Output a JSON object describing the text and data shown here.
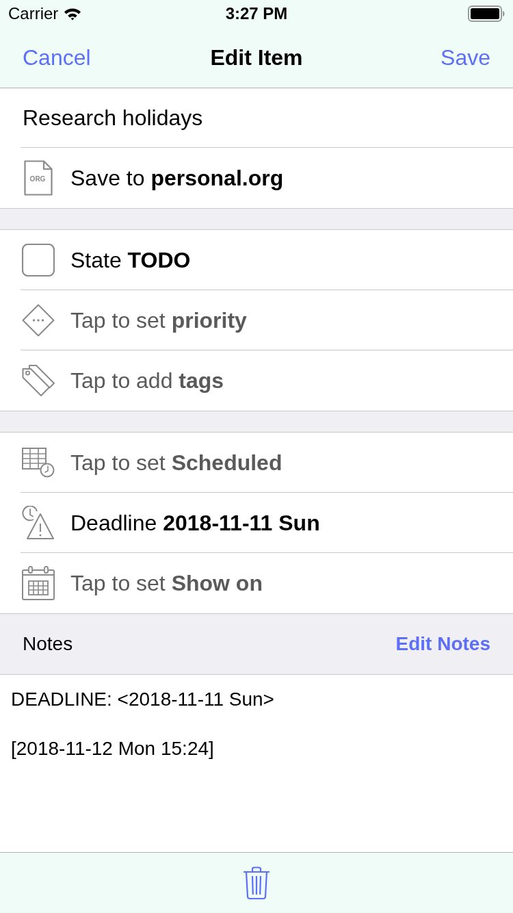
{
  "status_bar": {
    "carrier": "Carrier",
    "time": "3:27 PM"
  },
  "nav_bar": {
    "cancel": "Cancel",
    "title": "Edit Item",
    "save": "Save"
  },
  "title_field": {
    "value": "Research holidays"
  },
  "sections": [
    [
      {
        "kind": "file",
        "badge": "ORG",
        "text": "Save to **personal.org**",
        "set": true
      }
    ],
    [
      {
        "kind": "state",
        "text": "State **TODO**",
        "set": true,
        "checked": false
      },
      {
        "kind": "priority",
        "text": "Tap to set **priority**",
        "set": false
      },
      {
        "kind": "tags",
        "text": "Tap to add **tags**",
        "set": false
      }
    ],
    [
      {
        "kind": "scheduled",
        "text": "Tap to set **Scheduled**",
        "set": false
      },
      {
        "kind": "deadline",
        "text": "Deadline **2018-11-11 Sun**",
        "set": true
      },
      {
        "kind": "show_on",
        "text": "Tap to set **Show on**",
        "set": false
      }
    ]
  ],
  "notes": {
    "header": "Notes",
    "edit": "Edit Notes",
    "lines": [
      "DEADLINE: <2018-11-11 Sun>",
      "[2018-11-12 Mon 15:24]"
    ]
  }
}
